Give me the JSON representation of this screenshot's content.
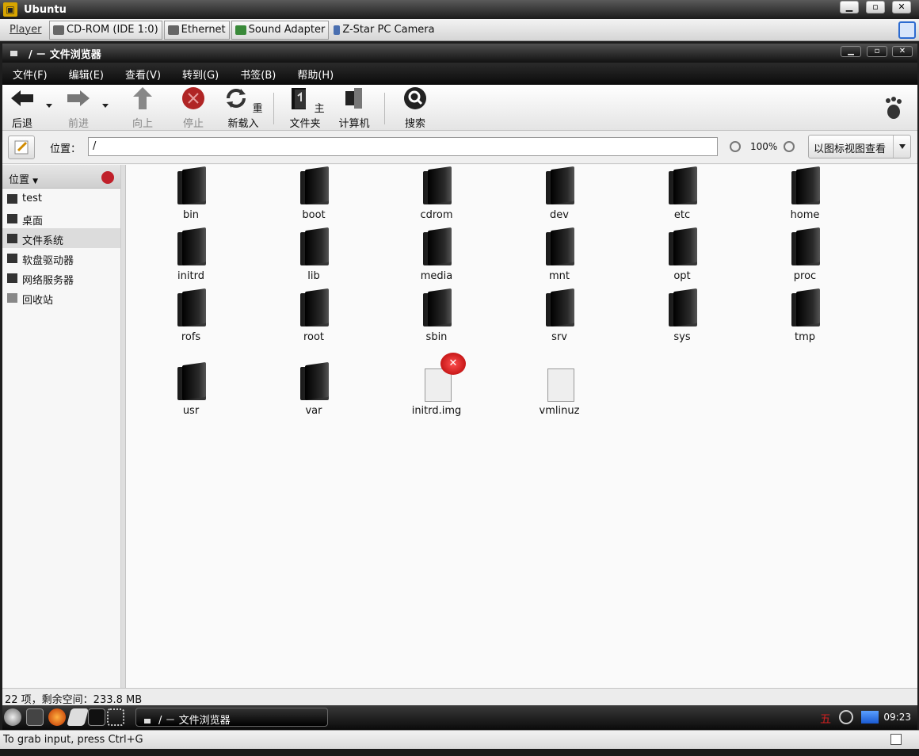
{
  "host": {
    "title": "Ubuntu",
    "player_label": "Player",
    "devices": [
      "CD-ROM (IDE 1:0)",
      "Ethernet",
      "Sound Adapter",
      "Z-Star PC Camera"
    ],
    "status_hint": "To grab input, press Ctrl+G"
  },
  "window": {
    "title": "/ － 文件浏览器"
  },
  "menu": [
    "文件(F)",
    "编辑(E)",
    "查看(V)",
    "转到(G)",
    "书签(B)",
    "帮助(H)"
  ],
  "toolbar": {
    "back": "后退",
    "forward": "前进",
    "up": "向上",
    "stop": "停止",
    "reload": "重新载入",
    "home": "主文件夹",
    "computer": "计算机",
    "search": "搜索"
  },
  "location": {
    "label": "位置：",
    "path": "/",
    "zoom": "100%",
    "view_mode": "以图标视图查看"
  },
  "sidebar": {
    "header": "位置",
    "items": [
      "test",
      "桌面",
      "文件系统",
      "软盘驱动器",
      "网络服务器",
      "回收站"
    ],
    "selected": "文件系统"
  },
  "files": [
    "bin",
    "boot",
    "cdrom",
    "dev",
    "etc",
    "home",
    "initrd",
    "lib",
    "media",
    "mnt",
    "opt",
    "proc",
    "rofs",
    "root",
    "sbin",
    "srv",
    "sys",
    "tmp",
    "usr",
    "var",
    "initrd.img",
    "vmlinuz"
  ],
  "status": "22 项，剩余空间：233.8 MB",
  "panel": {
    "task": "/ － 文件浏览器",
    "clock": "09:23",
    "ime": "五"
  }
}
